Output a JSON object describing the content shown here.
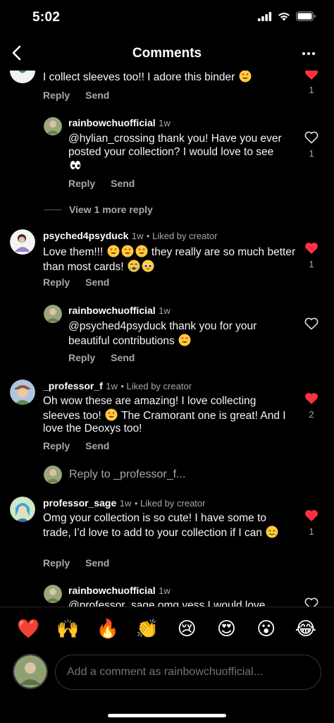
{
  "status": {
    "time": "5:02"
  },
  "header": {
    "title": "Comments",
    "back_icon": "chevron-left-icon",
    "more_icon": "more-horizontal-icon"
  },
  "comments": [
    {
      "text": "I collect sleeves too!! I adore this binder",
      "reply": "Reply",
      "send": "Send",
      "likes": "1",
      "liked": true,
      "replies": [
        {
          "username": "rainbowchuofficial",
          "time": "1w",
          "text": "@hylian_crossing thank you! Have you ever posted your collection? I would love to see",
          "reply": "Reply",
          "send": "Send",
          "likes": "1",
          "liked": false
        }
      ],
      "view_more": "View 1 more reply"
    },
    {
      "username": "psyched4psyduck",
      "time": "1w",
      "liked_by": "Liked by creator",
      "text_a": "Love them!!!",
      "text_b": "they really are so much better than most cards!",
      "reply": "Reply",
      "send": "Send",
      "likes": "1",
      "liked": true,
      "replies": [
        {
          "username": "rainbowchuofficial",
          "time": "1w",
          "text": "@psyched4psyduck thank you for your beautiful contributions",
          "reply": "Reply",
          "send": "Send",
          "liked": false
        }
      ]
    },
    {
      "username": "_professor_f",
      "time": "1w",
      "liked_by": "Liked by creator",
      "text_a": "Oh wow these are amazing! I love collecting sleeves too!",
      "text_b": "The Cramorant one is great! And I love the Deoxys too!",
      "reply": "Reply",
      "send": "Send",
      "likes": "2",
      "liked": true,
      "reply_to": "Reply to _professor_f..."
    },
    {
      "username": "professor_sage",
      "time": "1w",
      "liked_by": "Liked by creator",
      "text": "Omg your collection is so cute! I have some to trade, I’d love to add to your collection if I can",
      "reply": "Reply",
      "send": "Send",
      "likes": "1",
      "liked": true,
      "replies": [
        {
          "username": "rainbowchuofficial",
          "time": "1w",
          "text": "@professor_sage omg yess I would love"
        }
      ]
    }
  ],
  "quick_reactions": [
    "❤️",
    "🙌",
    "🔥",
    "👏",
    "😢",
    "😍",
    "😮",
    "😂"
  ],
  "composer": {
    "placeholder": "Add a comment as rainbowchuofficial..."
  },
  "colors": {
    "background": "#000000",
    "heart_red": "#ff3040",
    "secondary_text": "#a8a8a8"
  }
}
